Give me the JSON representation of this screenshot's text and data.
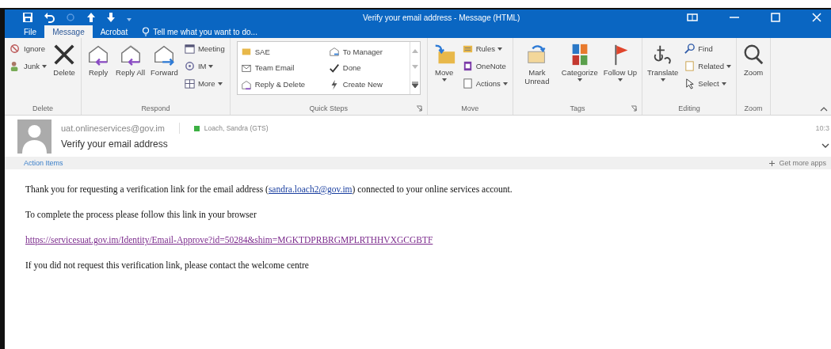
{
  "window": {
    "title": "Verify your email address - Message (HTML)"
  },
  "tabs": [
    {
      "label": "File",
      "selected": false
    },
    {
      "label": "Message",
      "selected": true
    },
    {
      "label": "Acrobat",
      "selected": false
    }
  ],
  "tell_me": {
    "placeholder": "Tell me what you want to do..."
  },
  "ribbon": [
    {
      "label": "Delete",
      "launcher": false,
      "columns": [
        [
          {
            "kind": "small",
            "label": "Ignore",
            "dropdown": false
          },
          {
            "kind": "small",
            "label": "Junk",
            "dropdown": true
          }
        ],
        [
          {
            "kind": "large",
            "label": "Delete",
            "dropdown": false
          }
        ]
      ]
    },
    {
      "label": "Respond",
      "launcher": false,
      "columns": [
        [
          {
            "kind": "large",
            "label": "Reply",
            "dropdown": false
          }
        ],
        [
          {
            "kind": "large",
            "label": "Reply All",
            "dropdown": false
          }
        ],
        [
          {
            "kind": "large",
            "label": "Forward",
            "dropdown": false
          }
        ],
        [
          {
            "kind": "small",
            "label": "Meeting",
            "dropdown": false
          },
          {
            "kind": "small",
            "label": "IM",
            "dropdown": true
          },
          {
            "kind": "small",
            "label": "More",
            "dropdown": true
          }
        ]
      ]
    },
    {
      "label": "Quick Steps",
      "launcher": true,
      "columns": [
        [
          {
            "kind": "gallery",
            "items": [
              {
                "label": "SAE"
              },
              {
                "label": "Team Email"
              },
              {
                "label": "Reply & Delete"
              },
              {
                "label": "To Manager"
              },
              {
                "label": "Done"
              },
              {
                "label": "Create New"
              }
            ]
          }
        ]
      ]
    },
    {
      "label": "Move",
      "launcher": false,
      "columns": [
        [
          {
            "kind": "large",
            "label": "Move",
            "dropdown": true
          }
        ],
        [
          {
            "kind": "small",
            "label": "Rules",
            "dropdown": true
          },
          {
            "kind": "small",
            "label": "OneNote",
            "dropdown": false
          },
          {
            "kind": "small",
            "label": "Actions",
            "dropdown": true
          }
        ]
      ]
    },
    {
      "label": "Tags",
      "launcher": true,
      "columns": [
        [
          {
            "kind": "large",
            "label": "Mark Unread",
            "dropdown": false
          }
        ],
        [
          {
            "kind": "large",
            "label": "Categorize",
            "dropdown": true
          }
        ],
        [
          {
            "kind": "large",
            "label": "Follow Up",
            "dropdown": true
          }
        ]
      ]
    },
    {
      "label": "Editing",
      "launcher": false,
      "columns": [
        [
          {
            "kind": "large",
            "label": "Translate",
            "dropdown": true
          }
        ],
        [
          {
            "kind": "small",
            "label": "Find",
            "dropdown": false
          },
          {
            "kind": "small",
            "label": "Related",
            "dropdown": true
          },
          {
            "kind": "small",
            "label": "Select",
            "dropdown": true
          }
        ]
      ]
    },
    {
      "label": "Zoom",
      "launcher": false,
      "columns": [
        [
          {
            "kind": "large",
            "label": "Zoom",
            "dropdown": false
          }
        ]
      ]
    }
  ],
  "message": {
    "from": "uat.onlineservices@gov.im",
    "to": {
      "name": "Loach, Sandra (GTS)",
      "color": "#3cb043"
    },
    "subject": "Verify your email address",
    "time": "10:3"
  },
  "action_bar": {
    "label": "Action Items",
    "apps": "Get more apps"
  },
  "body": [
    {
      "kind": "text_link",
      "before": "Thank you for requesting a verification link for the email address (",
      "link": "sandra.loach2@gov.im",
      "after": ") connected to your online services account."
    },
    {
      "kind": "text",
      "text": "To complete the process please follow this link in your browser"
    },
    {
      "kind": "link",
      "text": "https://servicesuat.gov.im/Identity/Email-Approve?id=50284&shim=MGKTDPRBRGMPLRTHHVXGCGBTF"
    },
    {
      "kind": "text",
      "text": "If you did not request this verification link, please contact the welcome centre"
    }
  ]
}
